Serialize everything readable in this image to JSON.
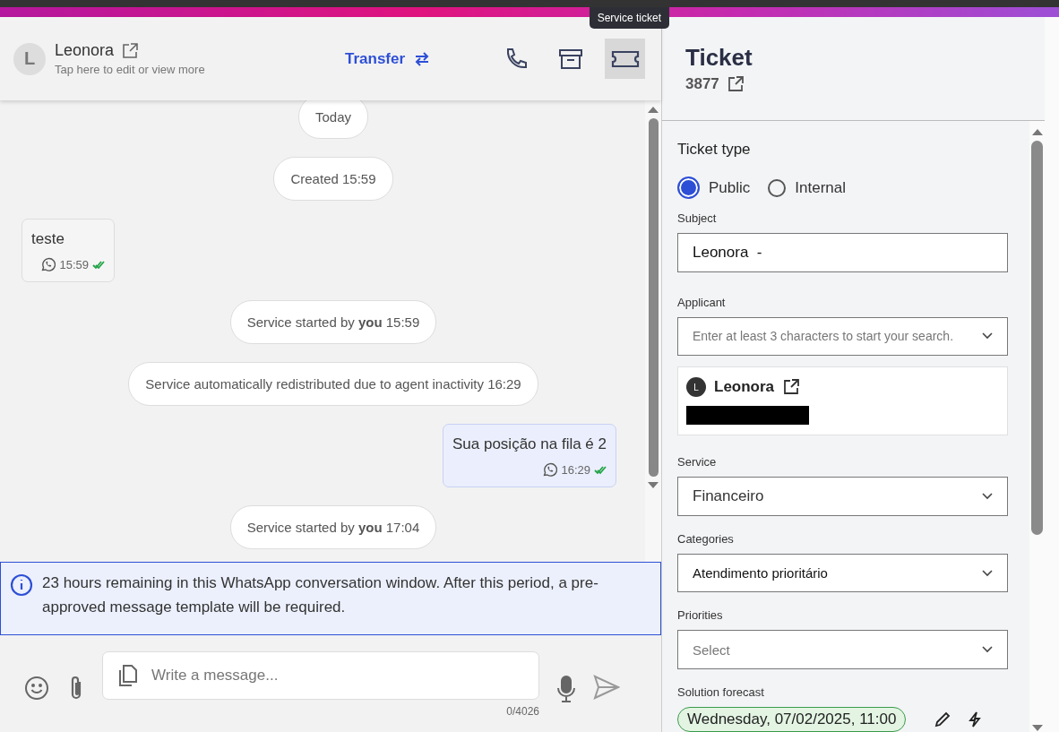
{
  "header": {
    "avatar_letter": "L",
    "contact_name": "Leonora",
    "subtitle": "Tap here to edit or view more",
    "transfer": "Transfer",
    "tooltip": "Service ticket",
    "actions": [
      {
        "kind": "phone",
        "selected": false
      },
      {
        "kind": "archive",
        "selected": false
      },
      {
        "kind": "ticket",
        "selected": true
      }
    ]
  },
  "messages": [
    {
      "kind": "system",
      "text": "Today"
    },
    {
      "kind": "system",
      "text": "Created 15:59"
    },
    {
      "kind": "incoming",
      "text": "teste",
      "time": "15:59"
    },
    {
      "kind": "system",
      "text": "Service started by **you** 15:59"
    },
    {
      "kind": "system",
      "text": "Service automatically redistributed due to agent inactivity 16:29"
    },
    {
      "kind": "outgoing",
      "text": "Sua posição na fila é 2",
      "time": "16:29"
    },
    {
      "kind": "system",
      "text": "Service started by **you** 17:04"
    }
  ],
  "notice": "23 hours remaining in this WhatsApp conversation window. After this period, a pre-approved message template will be required.",
  "composer": {
    "placeholder": "Write a message...",
    "counter": "0/4026"
  },
  "ticket": {
    "title": "Ticket",
    "number": "3877",
    "type_label": "Ticket type",
    "types": [
      {
        "label": "Public",
        "selected": true
      },
      {
        "label": "Internal",
        "selected": false
      }
    ],
    "subject_label": "Subject",
    "subject": "Leonora  -",
    "applicant_label": "Applicant",
    "applicant_placeholder": "Enter at least 3 characters to start your search.",
    "applicant": {
      "avatar_letter": "L",
      "name": "Leonora"
    },
    "service_label": "Service",
    "service": "Financeiro",
    "categories_label": "Categories",
    "category": "Atendimento prioritário",
    "priorities_label": "Priorities",
    "priority_placeholder": "Select",
    "forecast_label": "Solution forecast",
    "forecast": "Wednesday, 07/02/2025, 11:00"
  }
}
